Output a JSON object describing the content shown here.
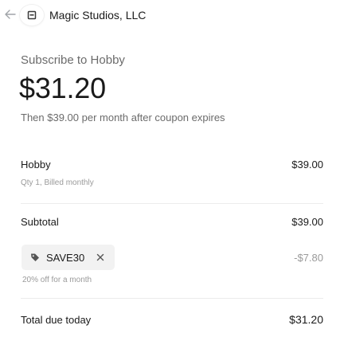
{
  "header": {
    "merchant_name": "Magic Studios, LLC",
    "back_icon": "arrow-left-icon",
    "logo_icon": "merchant-logo"
  },
  "summary": {
    "subscribe_title": "Subscribe to Hobby",
    "price": "$31.20",
    "price_note": "Then $39.00 per month after coupon expires"
  },
  "line_item": {
    "name": "Hobby",
    "details": "Qty 1, Billed monthly",
    "amount": "$39.00"
  },
  "subtotal": {
    "label": "Subtotal",
    "amount": "$39.00"
  },
  "coupon": {
    "code": "SAVE30",
    "description": "20% off for a month",
    "discount": "-$7.80",
    "tag_icon": "tag-icon",
    "remove_icon": "close-icon"
  },
  "total": {
    "label": "Total due today",
    "amount": "$31.20"
  },
  "colors": {
    "text_primary": "#1a1a1a",
    "text_secondary": "#6b6b6b",
    "text_muted": "#9a9a9a",
    "pill_background": "#f2f2f2",
    "divider": "#ececec"
  }
}
